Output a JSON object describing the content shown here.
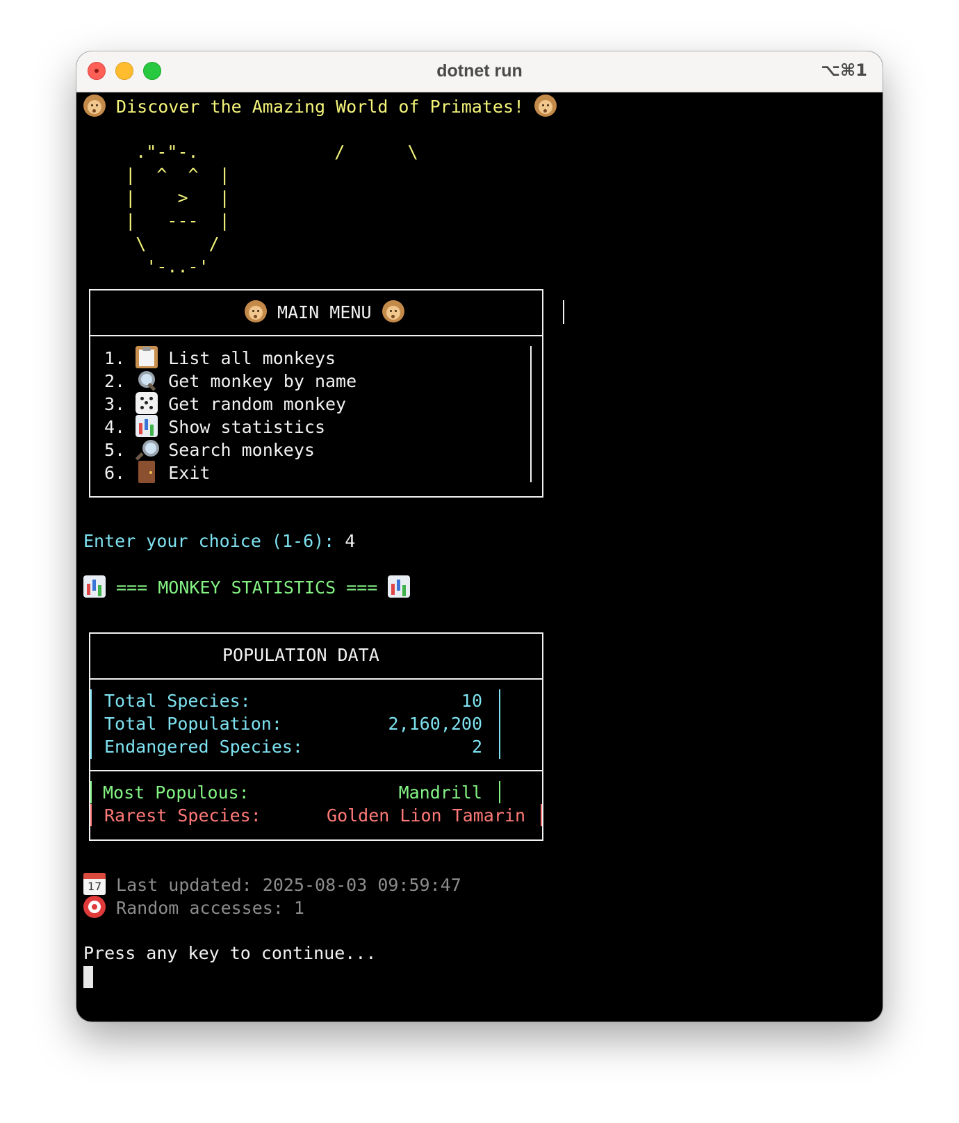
{
  "window": {
    "title": "dotnet run",
    "shortcut": "⌥⌘1"
  },
  "banner": {
    "text": " Discover the Amazing World of Primates! ",
    "icon_left": "monkey-face-icon",
    "icon_right": "monkey-face-icon"
  },
  "ascii_art": [
    "     .\"-\"-.             /      \\",
    "    |  ^  ^  |",
    "    |    >   |",
    "    |   ---  |",
    "     \\      /",
    "      '-..-'"
  ],
  "main_menu": {
    "title": " MAIN MENU ",
    "title_icon": "monkey-face-icon",
    "items": [
      {
        "number": "1.",
        "icon": "clipboard-icon",
        "label": "List all monkeys"
      },
      {
        "number": "2.",
        "icon": "magnifier-left-icon",
        "label": "Get monkey by name"
      },
      {
        "number": "3.",
        "icon": "dice-icon",
        "label": "Get random monkey"
      },
      {
        "number": "4.",
        "icon": "bar-chart-icon",
        "label": "Show statistics"
      },
      {
        "number": "5.",
        "icon": "magnifier-right-icon",
        "label": "Search monkeys"
      },
      {
        "number": "6.",
        "icon": "door-icon",
        "label": "Exit"
      }
    ]
  },
  "prompt": {
    "label": "Enter your choice (1-6): ",
    "value": "4"
  },
  "stats_header": {
    "text": " === MONKEY STATISTICS === ",
    "icon": "bar-chart-icon"
  },
  "population": {
    "title": "POPULATION DATA",
    "rows": [
      {
        "label": "Total Species:",
        "value": "10"
      },
      {
        "label": "Total Population:",
        "value": "2,160,200"
      },
      {
        "label": "Endangered Species:",
        "value": "2"
      }
    ],
    "most_populous": {
      "label": "Most Populous:",
      "value": "Mandrill"
    },
    "rarest": {
      "label": "Rarest Species:",
      "value": "Golden Lion Tamarin"
    }
  },
  "footer": {
    "last_updated_label": " Last updated: 2025-08-03 09:59:47",
    "random_accesses_label": " Random accesses: 1",
    "icons": [
      "calendar-icon",
      "target-icon"
    ]
  },
  "continue_text": "Press any key to continue...",
  "colors": {
    "yellow": "#f5f57a",
    "cyan": "#7ee2f0",
    "green": "#84f484",
    "red": "#ff7a78",
    "gray": "#8c8c8c"
  }
}
